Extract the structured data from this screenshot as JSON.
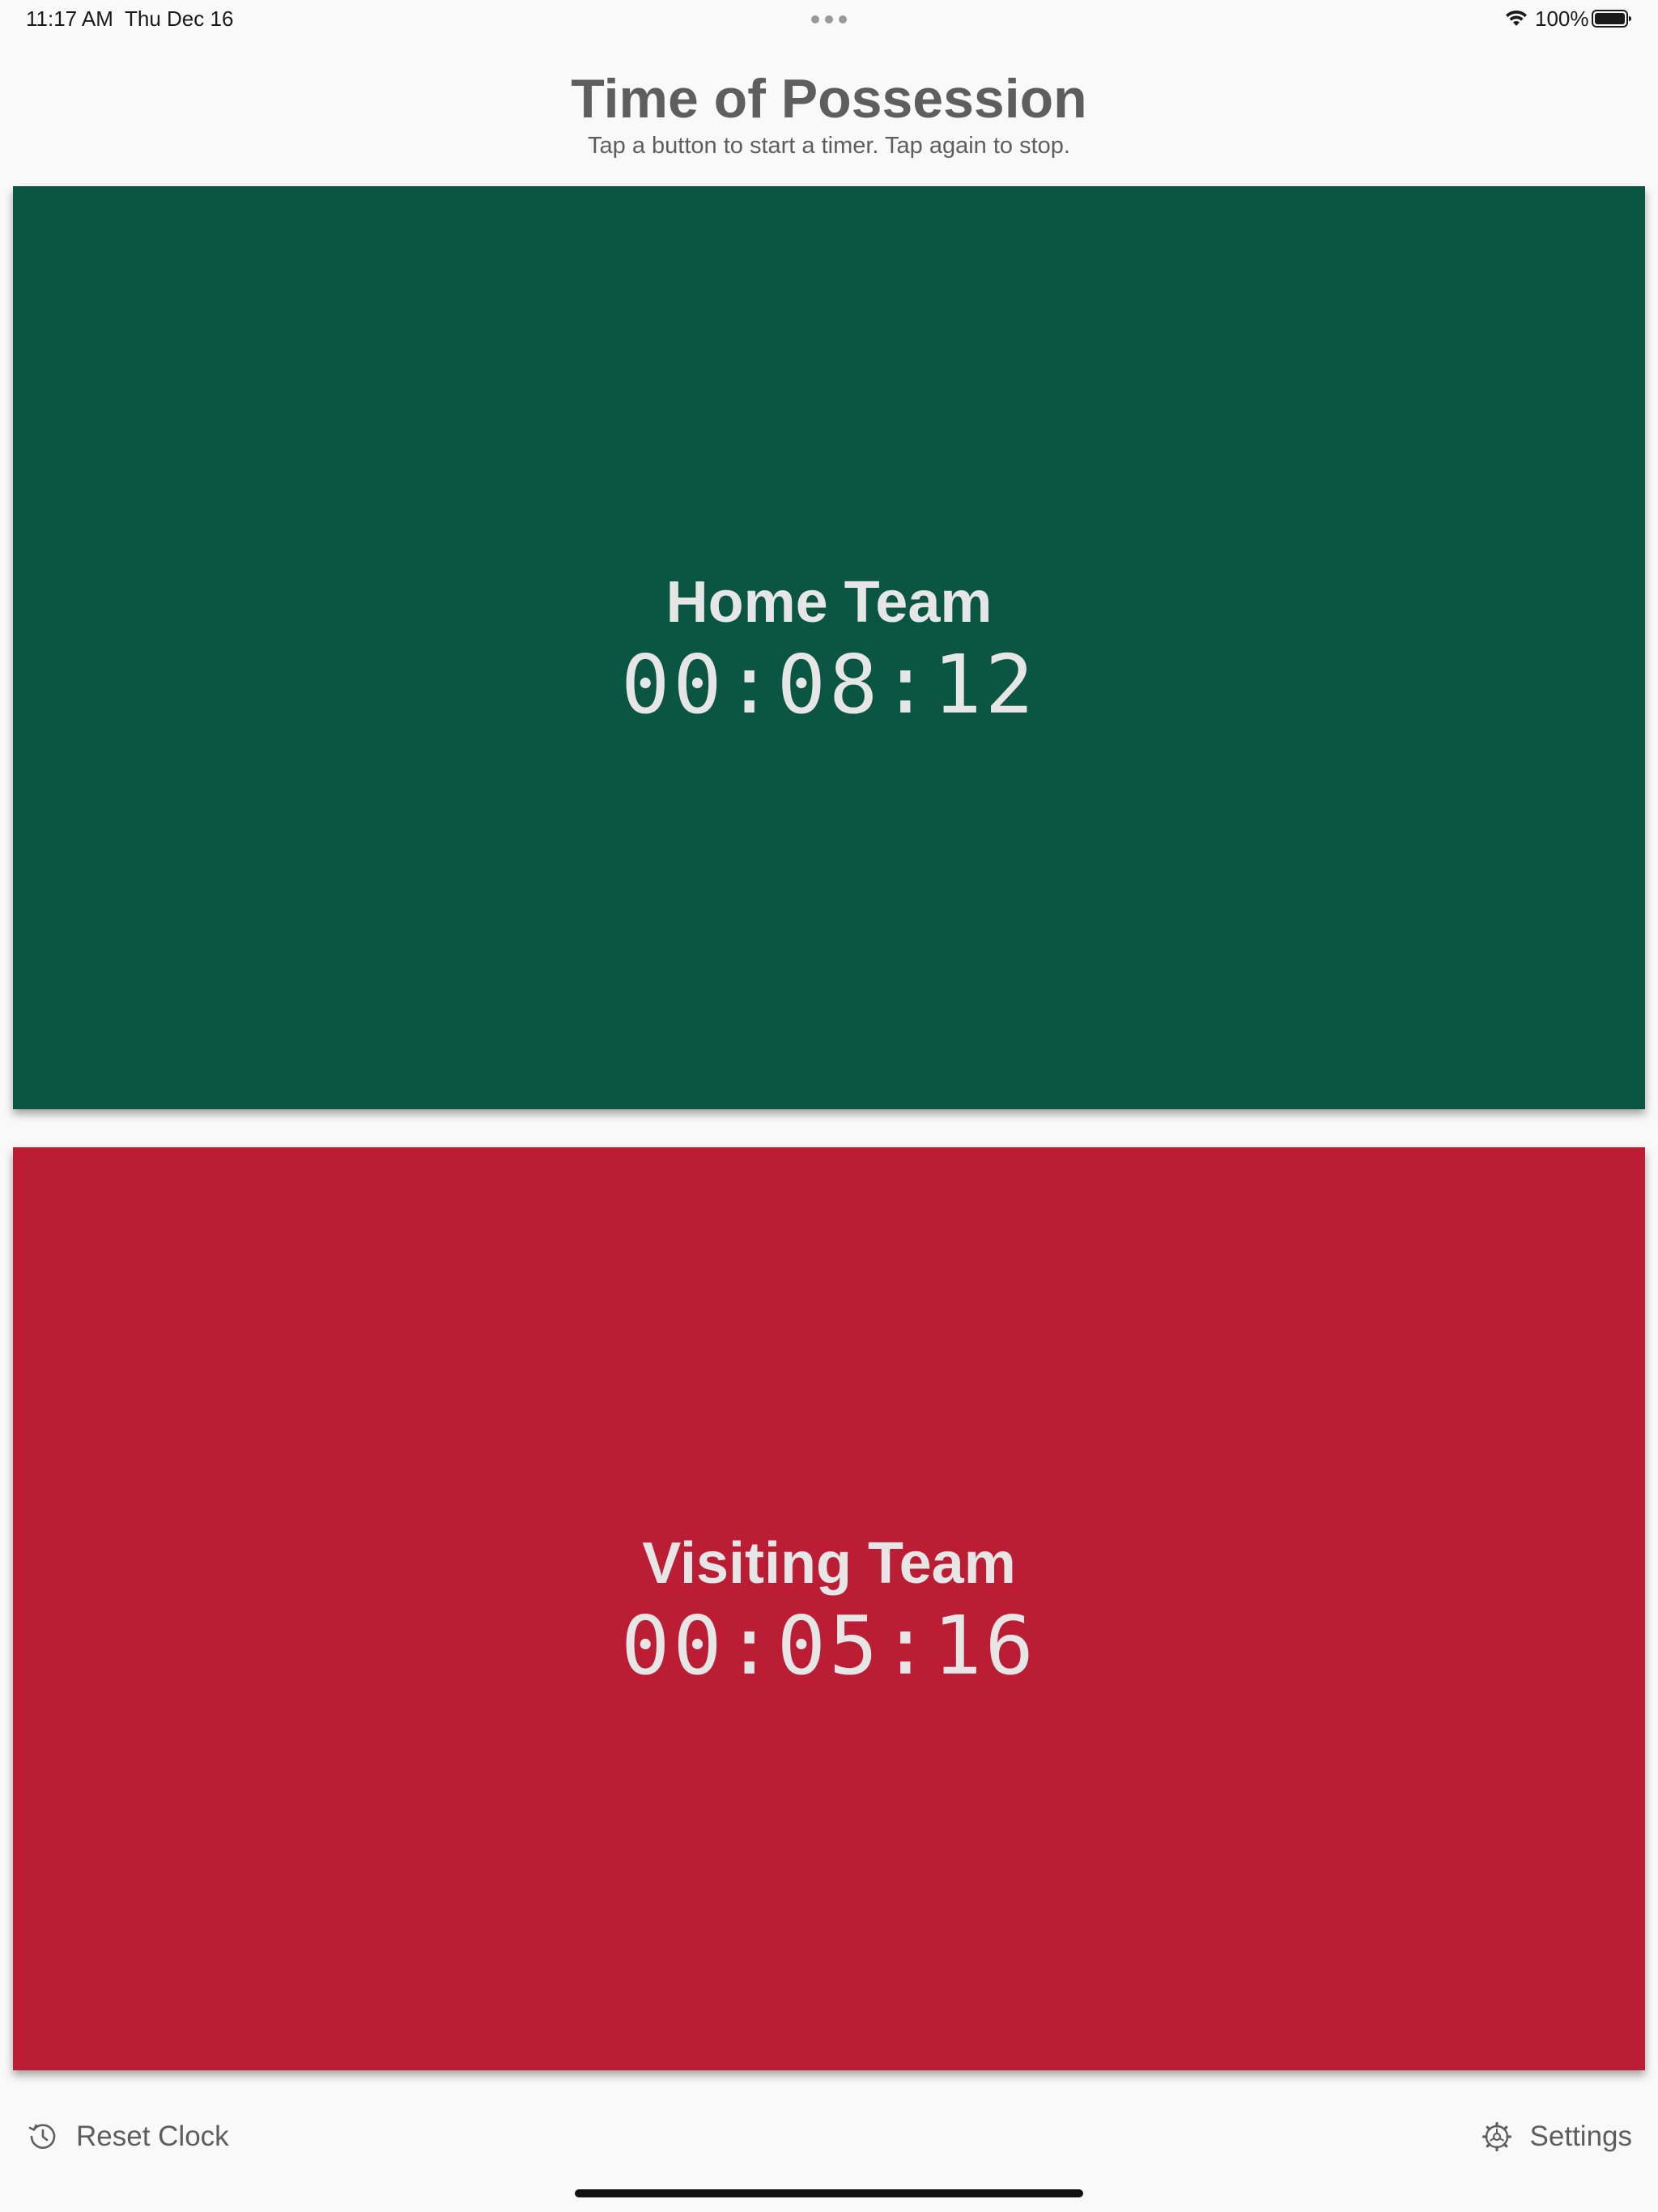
{
  "status_bar": {
    "time": "11:17 AM",
    "date": "Thu Dec 16",
    "battery": "100%",
    "icons": [
      "wifi-icon",
      "battery-icon",
      "multitask-dots-icon"
    ]
  },
  "header": {
    "title": "Time of Possession",
    "subtitle": "Tap a button to start a timer. Tap again to stop."
  },
  "teams": [
    {
      "name": "Home Team",
      "time": "00:08:12",
      "color": "#0b5543"
    },
    {
      "name": "Visiting Team",
      "time": "00:05:16",
      "color": "#bb1d34"
    }
  ],
  "toolbar": {
    "reset_label": "Reset Clock",
    "reset_icon": "clock-counterclockwise-icon",
    "settings_label": "Settings",
    "settings_icon": "gear-icon"
  },
  "colors": {
    "background": "#f9f9f9",
    "text": "#5e5e5e",
    "team_text": "#e6e6e6"
  }
}
